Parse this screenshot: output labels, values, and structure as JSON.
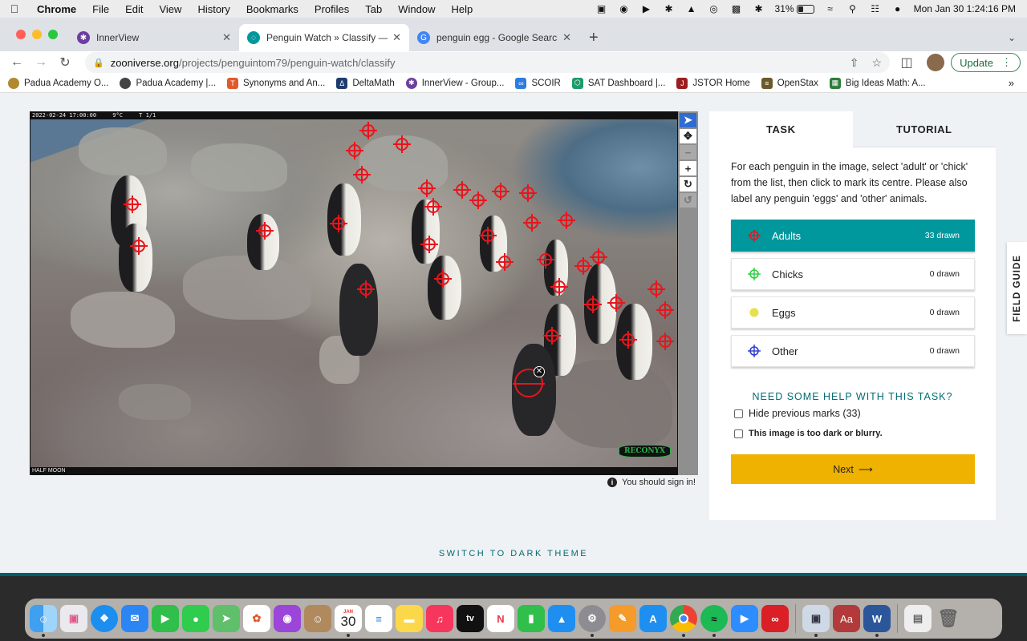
{
  "menubar": {
    "app": "Chrome",
    "items": [
      "File",
      "Edit",
      "View",
      "History",
      "Bookmarks",
      "Profiles",
      "Tab",
      "Window",
      "Help"
    ],
    "battery": "31%",
    "datetime": "Mon Jan 30  1:24:16 PM"
  },
  "tabs": [
    {
      "title": "InnerView",
      "favicon_color": "#6b3fa0",
      "active": false
    },
    {
      "title": "Penguin Watch » Classify — Zo",
      "favicon_color": "#00979d",
      "active": true
    },
    {
      "title": "penguin egg - Google Search",
      "favicon_color": "#4285f4",
      "active": false
    }
  ],
  "address": {
    "host": "zooniverse.org",
    "path": "/projects/penguintom79/penguin-watch/classify"
  },
  "update_label": "Update",
  "bookmarks": [
    {
      "label": "Padua Academy O...",
      "color": "#b08a2c"
    },
    {
      "label": "Padua Academy |...",
      "color": "#444444"
    },
    {
      "label": "Synonyms and An...",
      "color": "#e05a2b"
    },
    {
      "label": "DeltaMath",
      "color": "#1d3b6e"
    },
    {
      "label": "InnerView - Group...",
      "color": "#6b3fa0"
    },
    {
      "label": "SCOIR",
      "color": "#2d7de0"
    },
    {
      "label": "SAT Dashboard |...",
      "color": "#1f9b6b"
    },
    {
      "label": "JSTOR Home",
      "color": "#9a1e1e"
    },
    {
      "label": "OpenStax",
      "color": "#6a5a2a"
    },
    {
      "label": "Big Ideas Math: A...",
      "color": "#2c7d3a"
    }
  ],
  "photo": {
    "header": [
      "2022-02-24 17:00:00",
      "9°C",
      "T 1/1"
    ],
    "footer": "HALF MOON",
    "brand": "RECONYX"
  },
  "image_tools": [
    "pointer",
    "move",
    "zoom-out",
    "zoom-in",
    "rotate",
    "reset"
  ],
  "sign_in_note": "You should sign in!",
  "task": {
    "tabs": [
      "TASK",
      "TUTORIAL"
    ],
    "instructions": "For each penguin in the image, select 'adult' or 'chick' from the list, then click to mark its centre. Please also label any penguin 'eggs' and 'other' animals.",
    "choices": [
      {
        "label": "Adults",
        "count": "33 drawn",
        "selected": true,
        "icon_color": "#e8151c",
        "icon": "crosshair-icon"
      },
      {
        "label": "Chicks",
        "count": "0 drawn",
        "selected": false,
        "icon_color": "#2ecc40",
        "icon": "crosshair-icon"
      },
      {
        "label": "Eggs",
        "count": "0 drawn",
        "selected": false,
        "icon_color": "#e6e04a",
        "icon": "dot-icon"
      },
      {
        "label": "Other",
        "count": "0 drawn",
        "selected": false,
        "icon_color": "#2b3cd1",
        "icon": "crosshair-icon"
      }
    ],
    "help": "NEED SOME HELP WITH THIS TASK?",
    "hide_marks": "Hide previous marks (33)",
    "too_dark": "This image is too dark or blurry.",
    "next": "Next",
    "next_arrow": "⟶"
  },
  "field_guide": "FIELD GUIDE",
  "theme_toggle": "SWITCH TO DARK THEME",
  "dock": {
    "calendar_day": "30",
    "calendar_month": "JAN"
  }
}
